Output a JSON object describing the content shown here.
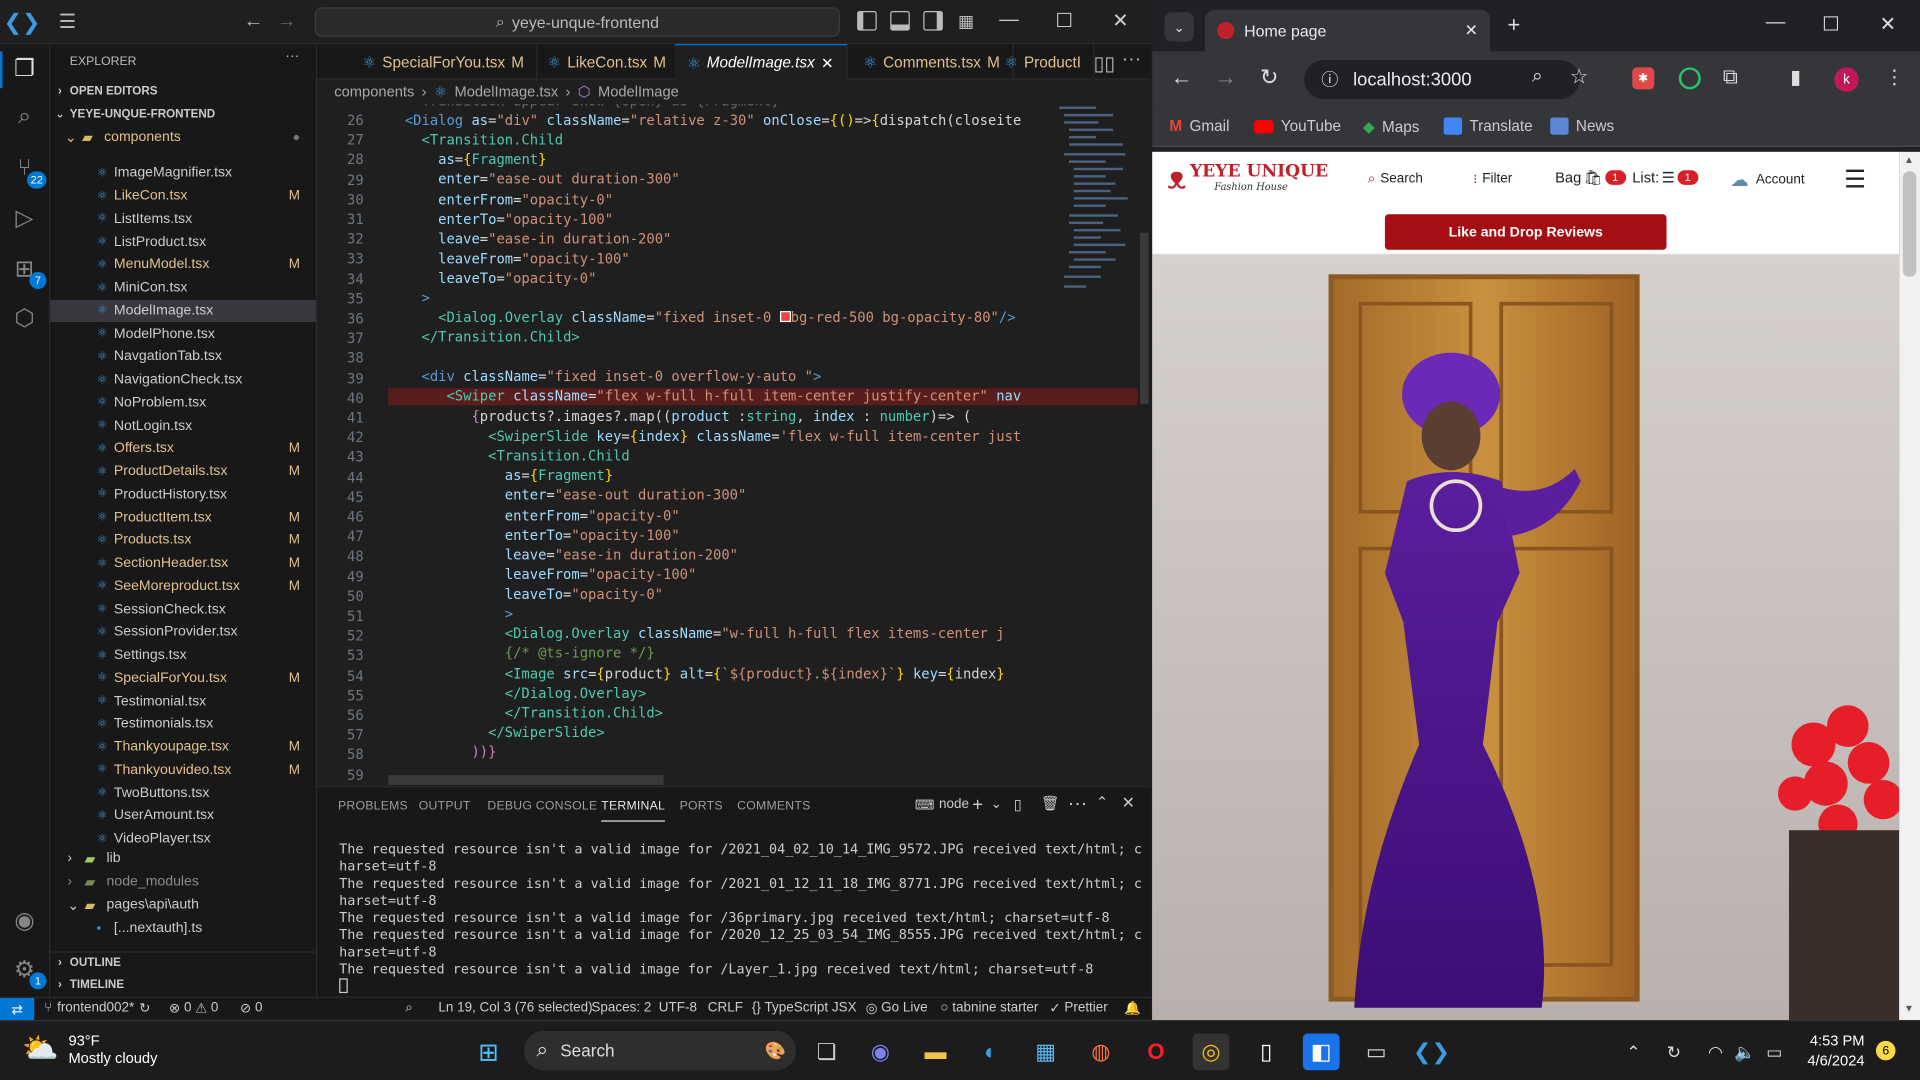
{
  "vscode": {
    "search_text": "yeye-unque-frontend",
    "explorer_title": "EXPLORER",
    "open_editors": "OPEN EDITORS",
    "project": "YEYE-UNQUE-FRONTEND",
    "folder": "components",
    "files": [
      {
        "name": "ImageMagnifier.tsx",
        "m": ""
      },
      {
        "name": "LikeCon.tsx",
        "m": "M"
      },
      {
        "name": "ListItems.tsx",
        "m": ""
      },
      {
        "name": "ListProduct.tsx",
        "m": ""
      },
      {
        "name": "MenuModel.tsx",
        "m": "M"
      },
      {
        "name": "MiniCon.tsx",
        "m": ""
      },
      {
        "name": "ModelImage.tsx",
        "m": ""
      },
      {
        "name": "ModelPhone.tsx",
        "m": ""
      },
      {
        "name": "NavgationTab.tsx",
        "m": ""
      },
      {
        "name": "NavigationCheck.tsx",
        "m": ""
      },
      {
        "name": "NoProblem.tsx",
        "m": ""
      },
      {
        "name": "NotLogin.tsx",
        "m": ""
      },
      {
        "name": "Offers.tsx",
        "m": "M"
      },
      {
        "name": "ProductDetails.tsx",
        "m": "M"
      },
      {
        "name": "ProductHistory.tsx",
        "m": ""
      },
      {
        "name": "ProductItem.tsx",
        "m": "M"
      },
      {
        "name": "Products.tsx",
        "m": "M"
      },
      {
        "name": "SectionHeader.tsx",
        "m": "M"
      },
      {
        "name": "SeeMoreproduct.tsx",
        "m": "M"
      },
      {
        "name": "SessionCheck.tsx",
        "m": ""
      },
      {
        "name": "SessionProvider.tsx",
        "m": ""
      },
      {
        "name": "Settings.tsx",
        "m": ""
      },
      {
        "name": "SpecialForYou.tsx",
        "m": "M"
      },
      {
        "name": "Testimonial.tsx",
        "m": ""
      },
      {
        "name": "Testimonials.tsx",
        "m": ""
      },
      {
        "name": "Thankyoupage.tsx",
        "m": "M"
      },
      {
        "name": "Thankyouvideo.tsx",
        "m": "M"
      },
      {
        "name": "TwoButtons.tsx",
        "m": ""
      },
      {
        "name": "UserAmount.tsx",
        "m": ""
      },
      {
        "name": "VideoPlayer.tsx",
        "m": ""
      }
    ],
    "lib": "lib",
    "node_modules": "node_modules",
    "pages_api_auth": "pages\\api\\auth",
    "nextauth": "[...nextauth].ts",
    "outline": "OUTLINE",
    "timeline": "TIMELINE",
    "tabs": [
      {
        "label": "SpecialForYou.tsx",
        "m": "M"
      },
      {
        "label": "LikeCon.tsx",
        "m": "M"
      },
      {
        "label": "ModelImage.tsx",
        "m": ""
      },
      {
        "label": "Comments.tsx",
        "m": "M"
      },
      {
        "label": "ProductI",
        "m": ""
      }
    ],
    "crumb_components": "components",
    "crumb_file": "ModelImage.tsx",
    "crumb_symbol": "ModelImage",
    "line_numbers": [
      "26",
      "27",
      "28",
      "29",
      "30",
      "31",
      "32",
      "33",
      "34",
      "35",
      "36",
      "37",
      "38",
      "39",
      "40",
      "41",
      "42",
      "43",
      "44",
      "45",
      "46",
      "47",
      "48",
      "49",
      "50",
      "51",
      "52",
      "53",
      "54",
      "55",
      "56",
      "57",
      "58",
      "59"
    ],
    "panel_tabs": [
      "PROBLEMS",
      "OUTPUT",
      "DEBUG CONSOLE",
      "TERMINAL",
      "PORTS",
      "COMMENTS"
    ],
    "terminal_name": "node",
    "terminal_lines": [
      "The requested resource isn't a valid image for /2021_04_02_10_14_IMG_9572.JPG received text/html; c",
      "harset=utf-8",
      "The requested resource isn't a valid image for /2021_01_12_11_18_IMG_8771.JPG received text/html; c",
      "harset=utf-8",
      "The requested resource isn't a valid image for /36primary.jpg received text/html; charset=utf-8",
      "The requested resource isn't a valid image for /2020_12_25_03_54_IMG_8555.JPG received text/html; c",
      "harset=utf-8",
      "The requested resource isn't a valid image for /Layer_1.jpg received text/html; charset=utf-8"
    ],
    "status": {
      "branch": "frontend002*",
      "errors": "0",
      "warnings": "0",
      "ports": "0",
      "position": "Ln 19, Col 3 (76 selected)",
      "spaces": "Spaces: 2",
      "encoding": "UTF-8",
      "eol": "CRLF",
      "language": "TypeScript JSX",
      "golive": "Go Live",
      "tabnine": "tabnine starter",
      "prettier": "Prettier"
    },
    "badges": {
      "scm": "22",
      "ext": "7",
      "settings": "1"
    }
  },
  "chrome": {
    "tab_title": "Home page",
    "url": "localhost:3000",
    "profile": "k",
    "bookmarks": [
      "Gmail",
      "YouTube",
      "Maps",
      "Translate",
      "News"
    ]
  },
  "site": {
    "brand": "YEYE UNIQUE",
    "brand_sub": "Fashion House",
    "nav": {
      "search": "Search",
      "filter": "Filter",
      "bag": "Bag",
      "bag_count": "1",
      "list": "List:",
      "list_count": "1",
      "account": "Account"
    },
    "banner_button": "Like and Drop Reviews",
    "accent": "#a50f14"
  },
  "taskbar": {
    "weather_temp": "93°F",
    "weather_desc": "Mostly cloudy",
    "search": "Search",
    "time": "4:53 PM",
    "date": "4/6/2024",
    "notif": "6"
  }
}
